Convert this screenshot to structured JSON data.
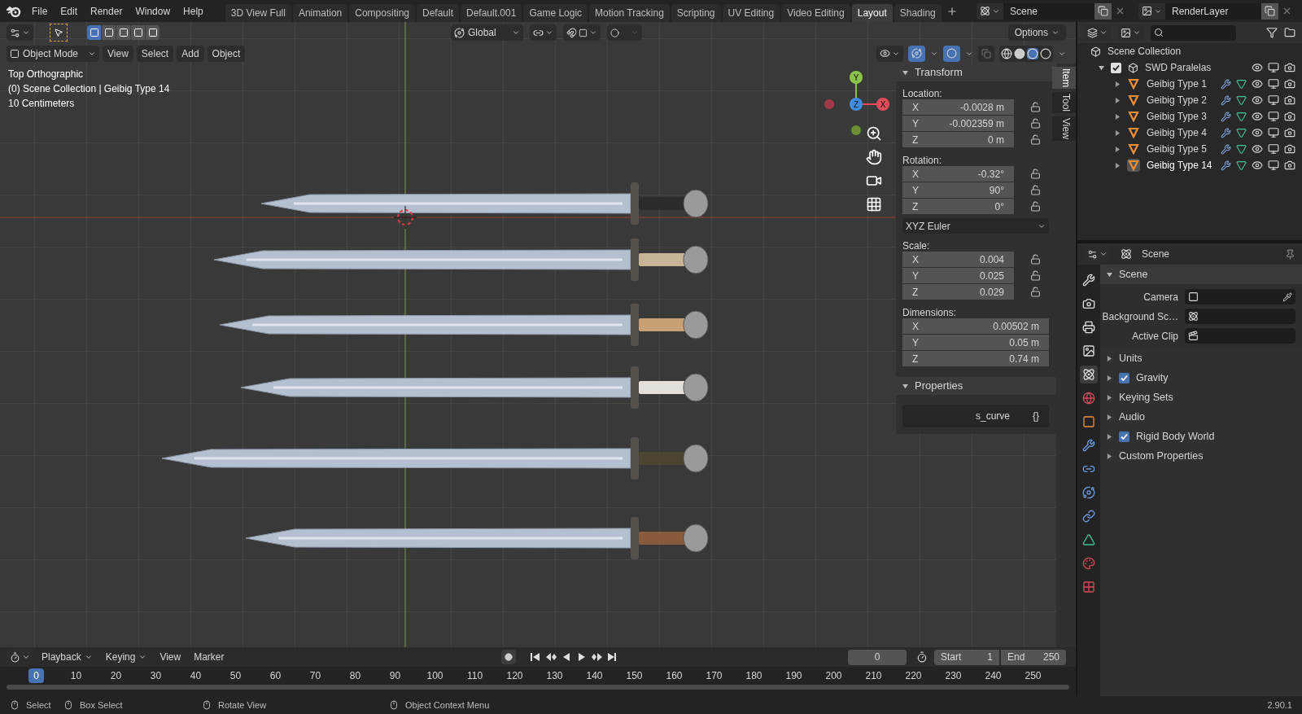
{
  "menu": [
    "File",
    "Edit",
    "Render",
    "Window",
    "Help"
  ],
  "workspaces": [
    {
      "label": "3D View Full",
      "selected": false
    },
    {
      "label": "Animation",
      "selected": false
    },
    {
      "label": "Compositing",
      "selected": false
    },
    {
      "label": "Default",
      "selected": false
    },
    {
      "label": "Default.001",
      "selected": false
    },
    {
      "label": "Game Logic",
      "selected": false
    },
    {
      "label": "Motion Tracking",
      "selected": false
    },
    {
      "label": "Scripting",
      "selected": false
    },
    {
      "label": "UV Editing",
      "selected": false
    },
    {
      "label": "Video Editing",
      "selected": false
    },
    {
      "label": "Layout",
      "selected": true
    },
    {
      "label": "Shading",
      "selected": false
    }
  ],
  "scene": "Scene",
  "view_layer": "RenderLayer",
  "tool_header": {
    "orientation": "Global",
    "options": "Options"
  },
  "viewport_header": {
    "mode": "Object Mode",
    "menus": [
      "View",
      "Select",
      "Add",
      "Object"
    ]
  },
  "overlay_text": [
    "Top Orthographic",
    "(0) Scene Collection | Geibig Type 14",
    "10 Centimeters"
  ],
  "gizmo_axes": [
    "Y",
    "Z",
    "X"
  ],
  "sidebar": {
    "tabs": [
      {
        "label": "Item",
        "selected": true
      },
      {
        "label": "Tool",
        "selected": false
      },
      {
        "label": "View",
        "selected": false
      }
    ],
    "transform_title": "Transform",
    "groups": [
      {
        "label": "Location:",
        "locks": true,
        "rows": [
          {
            "axis": "X",
            "value": "-0.0028 m"
          },
          {
            "axis": "Y",
            "value": "-0.002359 m"
          },
          {
            "axis": "Z",
            "value": "0 m"
          }
        ]
      },
      {
        "label": "Rotation:",
        "locks": true,
        "rows": [
          {
            "axis": "X",
            "value": "-0.32°"
          },
          {
            "axis": "Y",
            "value": "90°"
          },
          {
            "axis": "Z",
            "value": "0°"
          }
        ],
        "mode": "XYZ Euler"
      },
      {
        "label": "Scale:",
        "locks": true,
        "rows": [
          {
            "axis": "X",
            "value": "0.004"
          },
          {
            "axis": "Y",
            "value": "0.025"
          },
          {
            "axis": "Z",
            "value": "0.029"
          }
        ]
      },
      {
        "label": "Dimensions:",
        "locks": false,
        "rows": [
          {
            "axis": "X",
            "value": "0.00502 m"
          },
          {
            "axis": "Y",
            "value": "0.05 m"
          },
          {
            "axis": "Z",
            "value": "0.74 m"
          }
        ]
      }
    ],
    "properties_title": "Properties",
    "property": {
      "name": "s_curve",
      "value": "{}"
    }
  },
  "outliner": {
    "root": "Scene Collection",
    "collection": {
      "name": "SWD Paralelas",
      "checked": true,
      "expanded": true,
      "children": [
        {
          "name": "Geibig Type 1",
          "selected": false
        },
        {
          "name": "Geibig Type 2",
          "selected": false
        },
        {
          "name": "Geibig Type 3",
          "selected": false
        },
        {
          "name": "Geibig Type 4",
          "selected": false
        },
        {
          "name": "Geibig Type 5",
          "selected": false
        },
        {
          "name": "Geibig Type 14",
          "selected": true
        }
      ]
    }
  },
  "properties": {
    "context": "Scene",
    "tabs": [
      {
        "kind": "tool",
        "selected": false
      },
      {
        "kind": "render",
        "selected": false
      },
      {
        "kind": "output",
        "selected": false
      },
      {
        "kind": "view-layer",
        "selected": false
      },
      {
        "kind": "scene",
        "selected": true
      },
      {
        "kind": "world",
        "selected": false
      },
      {
        "kind": "object",
        "selected": false
      },
      {
        "kind": "modifier",
        "selected": false
      },
      {
        "kind": "particles",
        "selected": false
      },
      {
        "kind": "physics",
        "selected": false
      },
      {
        "kind": "constraints",
        "selected": false
      },
      {
        "kind": "data",
        "selected": false
      },
      {
        "kind": "material",
        "selected": false
      },
      {
        "kind": "texture",
        "selected": false
      }
    ],
    "panels": [
      {
        "label": "Scene",
        "expanded": true,
        "fields": [
          {
            "label": "Camera",
            "kind": "camera"
          },
          {
            "label": "Background Sc…",
            "kind": "scene"
          },
          {
            "label": "Active Clip",
            "kind": "clip"
          }
        ]
      },
      {
        "label": "Units",
        "expanded": false
      },
      {
        "label": "Gravity",
        "expanded": false,
        "checked": true
      },
      {
        "label": "Keying Sets",
        "expanded": false
      },
      {
        "label": "Audio",
        "expanded": false
      },
      {
        "label": "Rigid Body World",
        "expanded": false,
        "checked": true
      },
      {
        "label": "Custom Properties",
        "expanded": false
      }
    ]
  },
  "timeline": {
    "menus": [
      "Playback",
      "Keying",
      "View",
      "Marker"
    ],
    "current_frame": "0",
    "start_label": "Start",
    "start": "1",
    "end_label": "End",
    "end": "250",
    "ruler": [
      {
        "label": "0",
        "selected": true
      },
      {
        "label": "10",
        "selected": false
      },
      {
        "label": "20",
        "selected": false
      },
      {
        "label": "30",
        "selected": false
      },
      {
        "label": "40",
        "selected": false
      },
      {
        "label": "50",
        "selected": false
      },
      {
        "label": "60",
        "selected": false
      },
      {
        "label": "70",
        "selected": false
      },
      {
        "label": "80",
        "selected": false
      },
      {
        "label": "90",
        "selected": false
      },
      {
        "label": "100",
        "selected": false
      },
      {
        "label": "110",
        "selected": false
      },
      {
        "label": "120",
        "selected": false
      },
      {
        "label": "130",
        "selected": false
      },
      {
        "label": "140",
        "selected": false
      },
      {
        "label": "150",
        "selected": false
      },
      {
        "label": "160",
        "selected": false
      },
      {
        "label": "170",
        "selected": false
      },
      {
        "label": "180",
        "selected": false
      },
      {
        "label": "190",
        "selected": false
      },
      {
        "label": "200",
        "selected": false
      },
      {
        "label": "210",
        "selected": false
      },
      {
        "label": "220",
        "selected": false
      },
      {
        "label": "230",
        "selected": false
      },
      {
        "label": "240",
        "selected": false
      },
      {
        "label": "250",
        "selected": false
      }
    ]
  },
  "status_bar": {
    "hints": [
      "Select",
      "Box Select",
      "Rotate View",
      "Object Context Menu"
    ],
    "version": "2.90.1"
  }
}
